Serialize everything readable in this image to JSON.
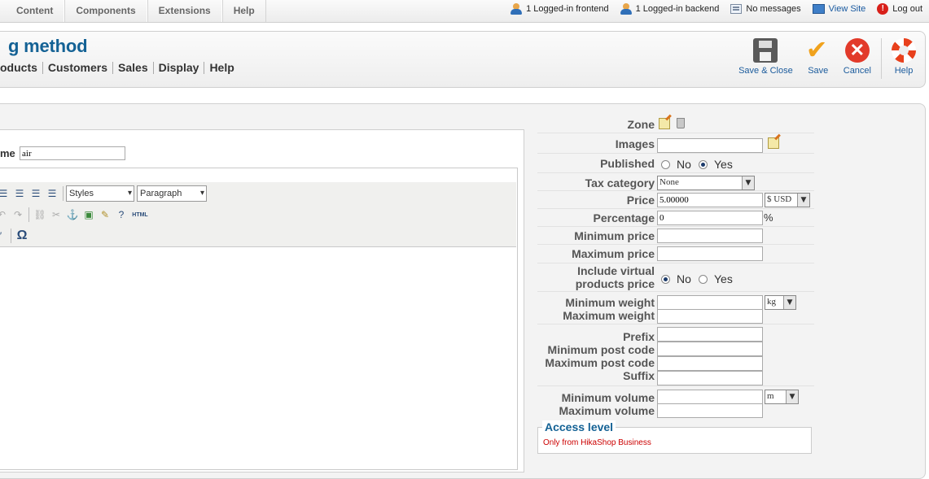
{
  "topmenu": {
    "items": [
      "Content",
      "Components",
      "Extensions",
      "Help"
    ]
  },
  "status": {
    "frontend": "1 Logged-in frontend",
    "backend": "1 Logged-in backend",
    "messages": "No messages",
    "view_site": "View Site",
    "logout": "Log out"
  },
  "header": {
    "title": "g method",
    "submenu": [
      "oducts",
      "Customers",
      "Sales",
      "Display",
      "Help"
    ]
  },
  "toolbar": {
    "save_close": "Save & Close",
    "save": "Save",
    "cancel": "Cancel",
    "help": "Help"
  },
  "editor": {
    "name_label": "me",
    "name_value": "air",
    "styles_label": "Styles",
    "format_label": "Paragraph",
    "html_label": "HTML",
    "omega": "Ω"
  },
  "form": {
    "zone": "Zone",
    "images": "Images",
    "published": "Published",
    "published_no": "No",
    "published_yes": "Yes",
    "published_value": "Yes",
    "tax_category": "Tax category",
    "tax_value": "None",
    "price": "Price",
    "price_value": "5.00000",
    "currency": "$ USD",
    "percentage": "Percentage",
    "percentage_value": "0",
    "percent_sign": "%",
    "min_price": "Minimum price",
    "max_price": "Maximum price",
    "include_virtual_1": "Include virtual",
    "include_virtual_2": "products price",
    "virtual_no": "No",
    "virtual_yes": "Yes",
    "virtual_value": "No",
    "min_weight": "Minimum weight",
    "max_weight": "Maximum weight",
    "weight_unit": "kg",
    "prefix": "Prefix",
    "min_post_code": "Minimum post code",
    "max_post_code": "Maximum post code",
    "suffix": "Suffix",
    "min_volume": "Minimum volume",
    "max_volume": "Maximum volume",
    "volume_unit": "m"
  },
  "access": {
    "title": "Access level",
    "text": "Only from HikaShop Business"
  }
}
